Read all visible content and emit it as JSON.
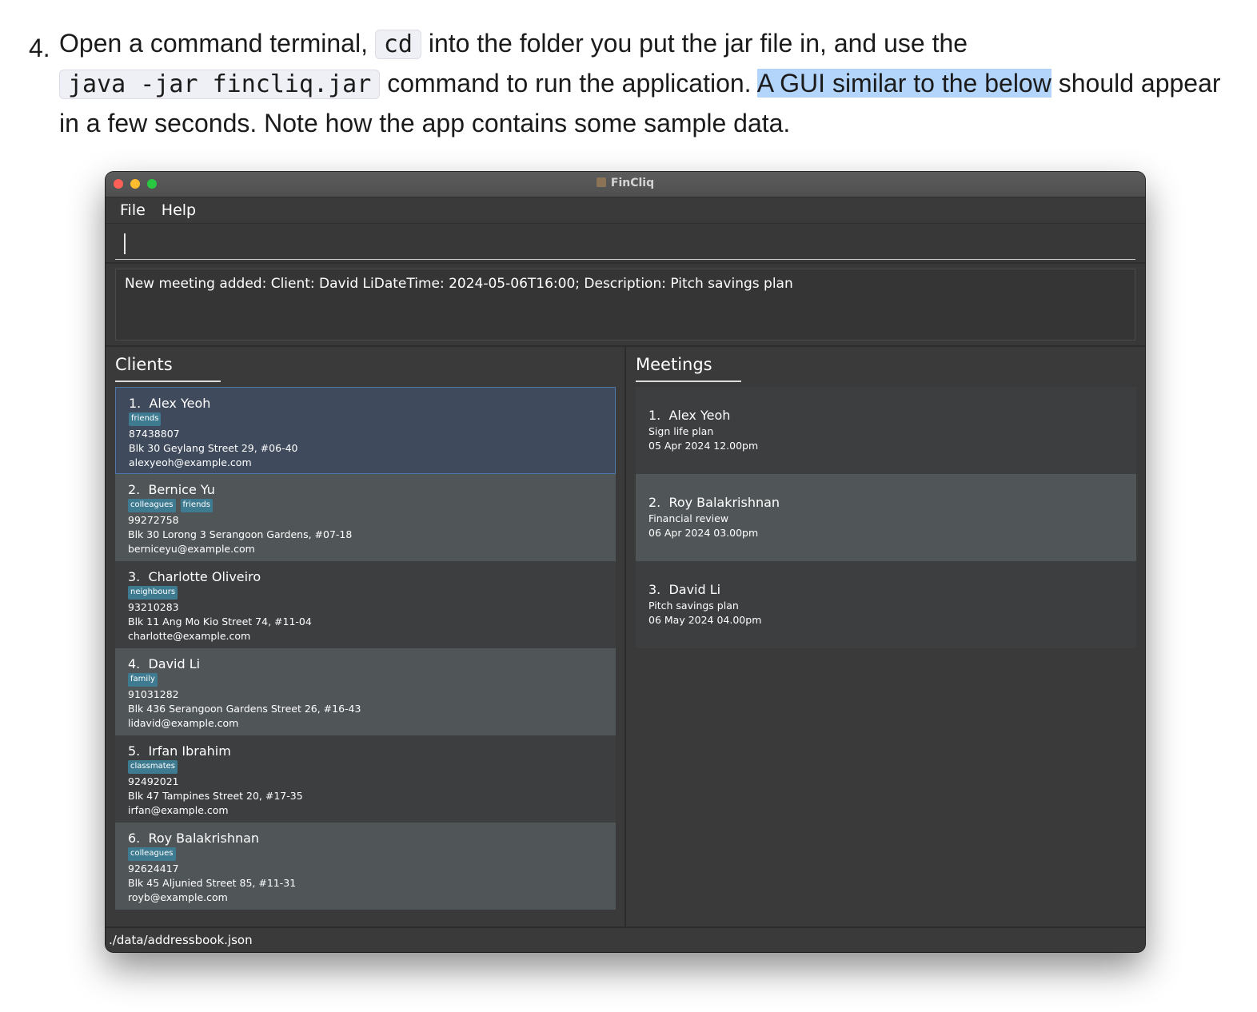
{
  "doc": {
    "step_number": "4.",
    "text1": "Open a command terminal,",
    "code1": "cd",
    "text2": "into the folder you put the jar file in, and use the",
    "code2": "java -jar fincliq.jar",
    "text3": "command to run the application.",
    "highlight": "A GUI similar to the below",
    "text4": "should appear in a few seconds. Note how the app contains some sample data."
  },
  "window": {
    "title": "FinCliq",
    "menu": [
      "File",
      "Help"
    ],
    "command_value": "",
    "result": "New meeting added: Client: David LiDateTime: 2024-05-06T16:00; Description: Pitch savings plan",
    "status": "./data/addressbook.json"
  },
  "clients": {
    "title": "Clients",
    "items": [
      {
        "index": "1.",
        "name": "Alex Yeoh",
        "tags": [
          "friends"
        ],
        "phone": "87438807",
        "address": "Blk 30 Geylang Street 29, #06-40",
        "email": "alexyeoh@example.com"
      },
      {
        "index": "2.",
        "name": "Bernice Yu",
        "tags": [
          "colleagues",
          "friends"
        ],
        "phone": "99272758",
        "address": "Blk 30 Lorong 3 Serangoon Gardens, #07-18",
        "email": "berniceyu@example.com"
      },
      {
        "index": "3.",
        "name": "Charlotte Oliveiro",
        "tags": [
          "neighbours"
        ],
        "phone": "93210283",
        "address": "Blk 11 Ang Mo Kio Street 74, #11-04",
        "email": "charlotte@example.com"
      },
      {
        "index": "4.",
        "name": "David Li",
        "tags": [
          "family"
        ],
        "phone": "91031282",
        "address": "Blk 436 Serangoon Gardens Street 26, #16-43",
        "email": "lidavid@example.com"
      },
      {
        "index": "5.",
        "name": "Irfan Ibrahim",
        "tags": [
          "classmates"
        ],
        "phone": "92492021",
        "address": "Blk 47 Tampines Street 20, #17-35",
        "email": "irfan@example.com"
      },
      {
        "index": "6.",
        "name": "Roy Balakrishnan",
        "tags": [
          "colleagues"
        ],
        "phone": "92624417",
        "address": "Blk 45 Aljunied Street 85, #11-31",
        "email": "royb@example.com"
      }
    ]
  },
  "meetings": {
    "title": "Meetings",
    "items": [
      {
        "index": "1.",
        "name": "Alex Yeoh",
        "description": "Sign life plan",
        "datetime": "05 Apr 2024 12.00pm"
      },
      {
        "index": "2.",
        "name": "Roy Balakrishnan",
        "description": "Financial review",
        "datetime": "06 Apr 2024 03.00pm"
      },
      {
        "index": "3.",
        "name": "David Li",
        "description": "Pitch savings plan",
        "datetime": "06 May 2024 04.00pm"
      }
    ]
  },
  "colors": {
    "highlight": "#b4d5fb",
    "tag": "#3e7b91",
    "selected_border": "#4c77a8"
  }
}
